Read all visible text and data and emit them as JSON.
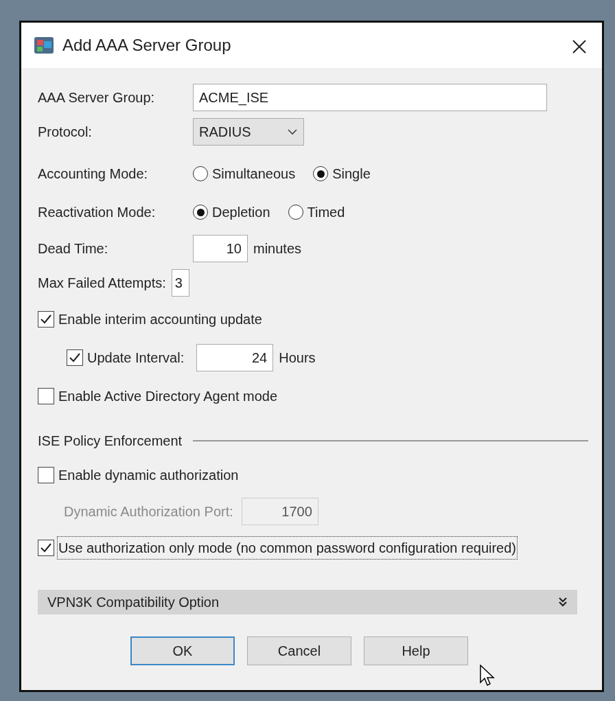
{
  "window": {
    "title": "Add AAA Server Group"
  },
  "server_group": {
    "label": "AAA Server Group:",
    "value": "ACME_ISE"
  },
  "protocol": {
    "label": "Protocol:",
    "value": "RADIUS"
  },
  "radio_groups": [
    {
      "label": "Accounting Mode:",
      "options": [
        {
          "label": "Simultaneous",
          "selected": false
        },
        {
          "label": "Single",
          "selected": true
        }
      ]
    },
    {
      "label": "Reactivation Mode:",
      "options": [
        {
          "label": "Depletion",
          "selected": true
        },
        {
          "label": "Timed",
          "selected": false
        }
      ]
    }
  ],
  "dead_time": {
    "label": "Dead Time:",
    "value": "10",
    "unit": "minutes"
  },
  "max_failed_attempts": {
    "label": "Max Failed Attempts:",
    "value": "3"
  },
  "checkboxes": [
    {
      "label": "Enable interim accounting update",
      "checked": true,
      "children": [
        {
          "label": "Update Interval:",
          "checked": true,
          "value": "24",
          "unit": "Hours"
        }
      ]
    },
    {
      "label": "Enable Active Directory Agent mode",
      "checked": false
    }
  ],
  "ise_policy_enforcement": {
    "title": "ISE Policy Enforcement",
    "dynamic_authorization": {
      "label": "Enable dynamic authorization",
      "checked": false
    },
    "port": {
      "label": "Dynamic Authorization Port:",
      "value": "1700",
      "disabled": true
    },
    "authorization_only": {
      "label": "Use authorization only mode (no common password configuration required)",
      "checked": true,
      "focused": true
    }
  },
  "collapsible": {
    "title": "VPN3K Compatibility Option",
    "expanded": false
  },
  "buttons": [
    {
      "label": "OK",
      "default": true
    },
    {
      "label": "Cancel",
      "default": false
    },
    {
      "label": "Help",
      "default": false
    }
  ]
}
